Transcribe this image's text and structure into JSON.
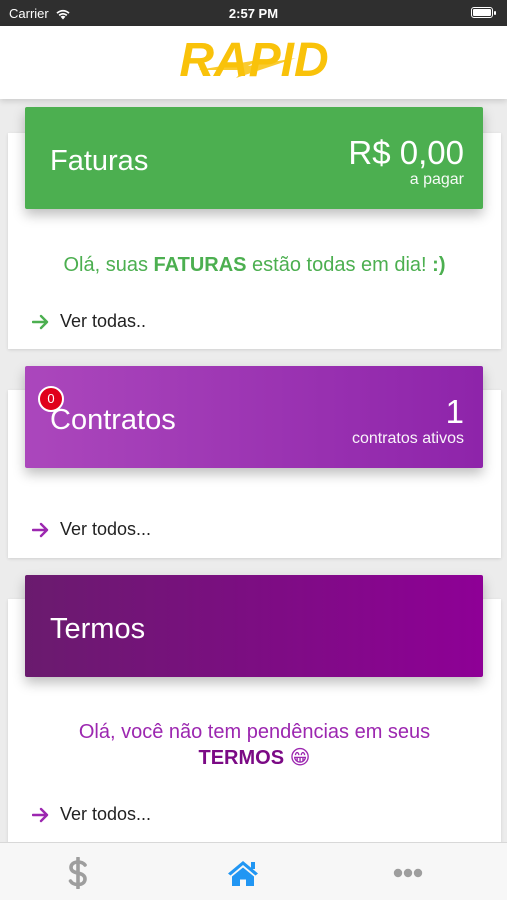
{
  "status_bar": {
    "carrier": "Carrier",
    "time": "2:57 PM"
  },
  "header": {
    "logo_text": "RAPID",
    "logo_color": "#f9c20a"
  },
  "faturas": {
    "title": "Faturas",
    "amount": "R$ 0,00",
    "amount_caption": "a pagar",
    "message_prefix": "Olá, suas ",
    "message_highlight": "FATURAS",
    "message_suffix": " estão todas em dia! ",
    "message_smiley": ":)",
    "see_all": "Ver todas..",
    "color": "#4caf50"
  },
  "contratos": {
    "badge": "0",
    "title": "Contratos",
    "count": "1",
    "count_caption": "contratos ativos",
    "see_all": "Ver todos...",
    "color": "#9c27b0"
  },
  "termos": {
    "title": "Termos",
    "message_line1": "Olá, você não tem pendências em seus",
    "message_highlight": "TERMOS",
    "message_emoji": "😁",
    "see_all": "Ver todos...",
    "color": "#7b0a85"
  },
  "tab_bar": {
    "tabs": [
      {
        "icon": "dollar-icon",
        "active": false
      },
      {
        "icon": "home-icon",
        "active": true
      },
      {
        "icon": "more-icon",
        "active": false
      }
    ],
    "active_color": "#2196f3",
    "inactive_color": "#9e9e9e"
  }
}
